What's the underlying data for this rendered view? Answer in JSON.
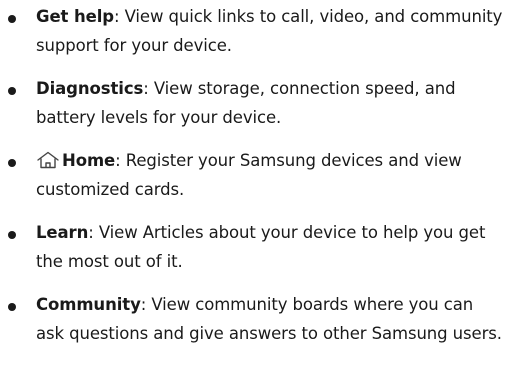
{
  "items": [
    {
      "term": "Get help",
      "desc": ": View quick links to call, video, and community support for your device."
    },
    {
      "term": "Diagnostics",
      "desc": ": View storage, connection speed, and battery levels for your device."
    },
    {
      "term": "Home",
      "icon": "home-icon",
      "desc": ": Register your Samsung devices and view customized cards."
    },
    {
      "term": "Learn",
      "desc": ": View Articles about your device to help you get the most out of it."
    },
    {
      "term": "Community",
      "desc": ": View community boards where you can ask questions and give answers to other Samsung users."
    }
  ]
}
